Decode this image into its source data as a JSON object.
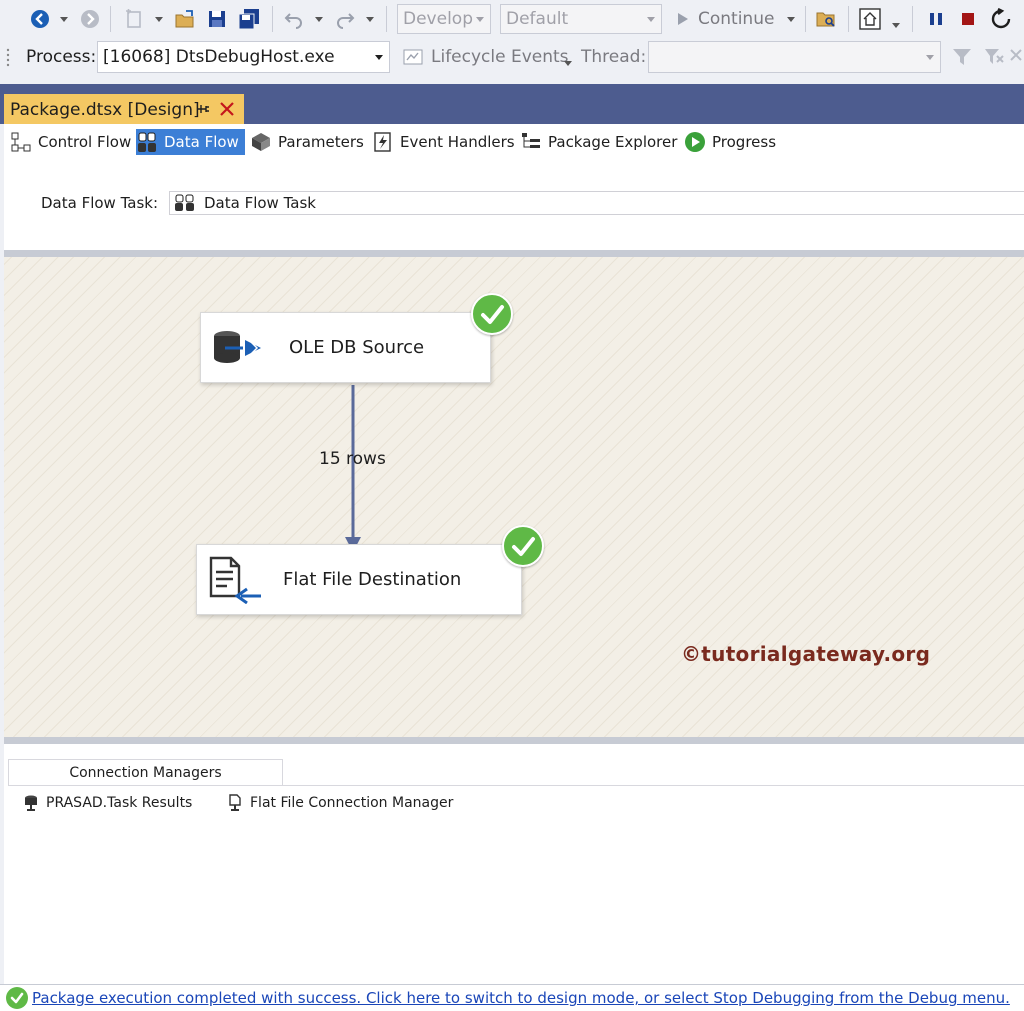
{
  "toolbar1": {
    "config_combo": "Develop",
    "platform_combo": "Default",
    "continue_label": "Continue"
  },
  "toolbar2": {
    "process_label": "Process:",
    "process_value": "[16068] DtsDebugHost.exe",
    "lifecycle_label": "Lifecycle Events",
    "thread_label": "Thread:"
  },
  "doc_tab": {
    "title": "Package.dtsx [Design]"
  },
  "designer_tabs": [
    {
      "label": "Control Flow"
    },
    {
      "label": "Data Flow"
    },
    {
      "label": "Parameters"
    },
    {
      "label": "Event Handlers"
    },
    {
      "label": "Package Explorer"
    },
    {
      "label": "Progress"
    }
  ],
  "active_tab": "Data Flow",
  "data_flow_task": {
    "label": "Data Flow Task:",
    "value": "Data Flow Task"
  },
  "canvas": {
    "source_name": "OLE DB Source",
    "destination_name": "Flat File Destination",
    "path_label": "15 rows",
    "watermark": "©tutorialgateway.org"
  },
  "connection_managers": {
    "tab_label": "Connection Managers",
    "items": [
      {
        "label": "PRASAD.Task Results"
      },
      {
        "label": "Flat File Connection Manager"
      }
    ]
  },
  "status": {
    "message": "Package execution completed with success. Click here to switch to design mode, or select Stop Debugging from the Debug menu."
  },
  "colors": {
    "accent": "#3c7fd6",
    "tab_strip": "#4d5c8f",
    "doc_tab": "#f4c863",
    "success": "#5fb946"
  }
}
